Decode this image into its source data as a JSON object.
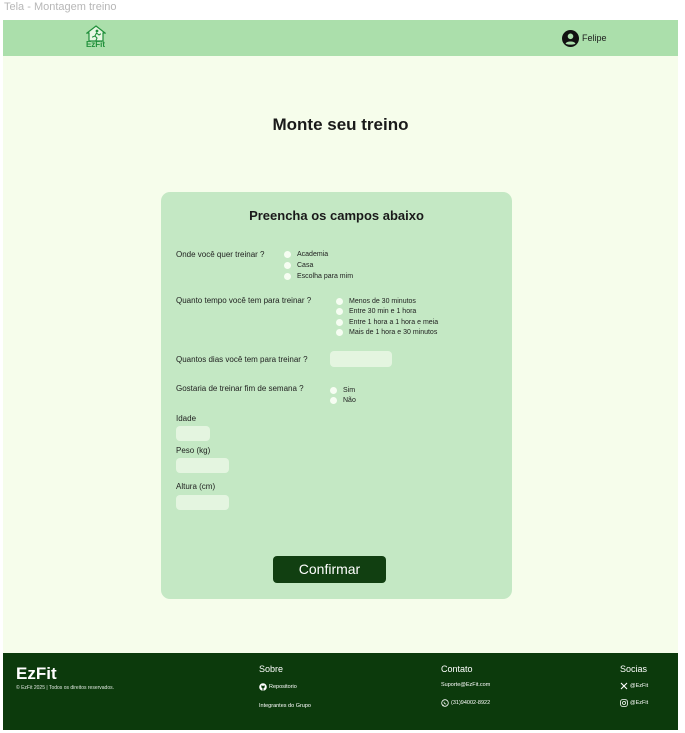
{
  "frame_label": "Tela - Montagem treino",
  "navbar": {
    "logo_text": "EzFit",
    "user_name": "Felipe"
  },
  "page_title": "Monte seu treino",
  "form": {
    "title": "Preencha os campos abaixo",
    "q_location": {
      "label": "Onde você quer treinar ?",
      "options": [
        "Academia",
        "Casa",
        "Escolha para mim"
      ]
    },
    "q_time": {
      "label": "Quanto tempo você tem para treinar ?",
      "options": [
        "Menos de 30 minutos",
        "Entre 30 min e 1 hora",
        "Entre 1 hora a 1 hora e meia",
        "Mais de 1 hora e 30 minutos"
      ]
    },
    "q_days": {
      "label": "Quantos dias você tem para treinar ?",
      "value": ""
    },
    "q_weekend": {
      "label": "Gostaria de treinar fim de semana ?",
      "options": [
        "Sim",
        "Não"
      ]
    },
    "age": {
      "label": "Idade",
      "value": ""
    },
    "weight": {
      "label": "Peso (kg)",
      "value": ""
    },
    "height": {
      "label": "Altura (cm)",
      "value": ""
    },
    "confirm_label": "Confirmar"
  },
  "footer": {
    "brand": "EzFit",
    "copyright": "© EzFit 2025 | Todos os direitos reservados.",
    "sobre": {
      "heading": "Sobre",
      "repo": "Repositorio",
      "group": "Integrantes do Grupo"
    },
    "contato": {
      "heading": "Contato",
      "email": "Suporte@EzFit.com",
      "phone": "(31)94002-8922"
    },
    "socias": {
      "heading": "Socias",
      "x": "@EzFit",
      "instagram": "@EzFit"
    }
  },
  "colors": {
    "navbar_bg": "#abdfab",
    "page_bg": "#f6fdeb",
    "card_bg": "#c4e8c4",
    "footer_bg": "#0c3a0c",
    "button_bg": "#113f11",
    "logo_green": "#1f8f3a"
  },
  "icons": {
    "logo": "house-runner-icon",
    "user": "user-avatar-icon",
    "repo": "github-icon",
    "phone": "whatsapp-icon",
    "x": "x-twitter-icon",
    "instagram": "instagram-icon"
  }
}
